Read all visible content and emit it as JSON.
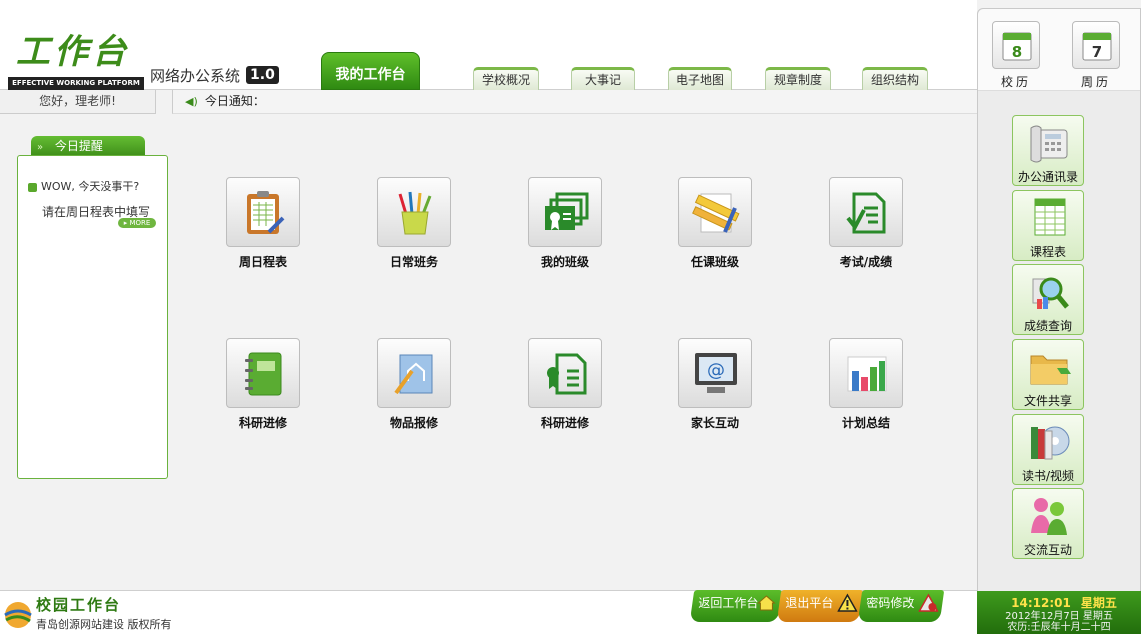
{
  "header": {
    "logo_text": "工作台",
    "logo_tagline": "EFFECTIVE WORKING PLATFORM",
    "system_name": "网络办公系统",
    "version": "1.0",
    "main_tab": "我的工作台",
    "nav_tabs": [
      "学校概况",
      "大事记",
      "电子地图",
      "规章制度",
      "组织结构"
    ]
  },
  "greeting": "您好，理老师!",
  "notice": {
    "label": "今日通知："
  },
  "reminder": {
    "title": "今日提醒",
    "line1": "WOW, 今天没事干?",
    "line2": "请在周日程表中填写",
    "more": "MORE"
  },
  "apps": [
    {
      "label": "周日程表",
      "icon": "clipboard-icon"
    },
    {
      "label": "日常班务",
      "icon": "pencil-cup-icon"
    },
    {
      "label": "我的班级",
      "icon": "certificate-icon"
    },
    {
      "label": "任课班级",
      "icon": "ruler-pencil-icon"
    },
    {
      "label": "考试/成绩",
      "icon": "exam-check-icon"
    },
    {
      "label": "科研进修",
      "icon": "notebook-icon"
    },
    {
      "label": "物品报修",
      "icon": "blueprint-icon"
    },
    {
      "label": "科研进修",
      "icon": "document-award-icon"
    },
    {
      "label": "家长互动",
      "icon": "email-monitor-icon"
    },
    {
      "label": "计划总结",
      "icon": "bar-chart-icon"
    }
  ],
  "sidebar": {
    "calendars": [
      {
        "label": "校历",
        "day": "8",
        "icon": "calendar-icon"
      },
      {
        "label": "周历",
        "day": "7",
        "icon": "calendar-icon"
      }
    ],
    "items": [
      {
        "label": "办公通讯录",
        "icon": "telephone-icon"
      },
      {
        "label": "课程表",
        "icon": "spreadsheet-icon"
      },
      {
        "label": "成绩查询",
        "icon": "magnifier-icon"
      },
      {
        "label": "文件共享",
        "icon": "folder-icon"
      },
      {
        "label": "读书/视频",
        "icon": "books-disc-icon"
      },
      {
        "label": "交流互动",
        "icon": "people-icon"
      }
    ]
  },
  "clock": {
    "time": "14:12:01",
    "weekday": "星期五",
    "date_line": "2012年12月7日  星期五",
    "lunar_line": "农历:壬辰年十月二十四"
  },
  "footer": {
    "brand": "校园工作台",
    "copyright": "青岛创源网站建设 版权所有",
    "buttons": [
      "返回工作台",
      "退出平台",
      "密码修改"
    ]
  },
  "colors": {
    "accent": "#3f8f1a",
    "clock_time": "#ffe24a"
  }
}
